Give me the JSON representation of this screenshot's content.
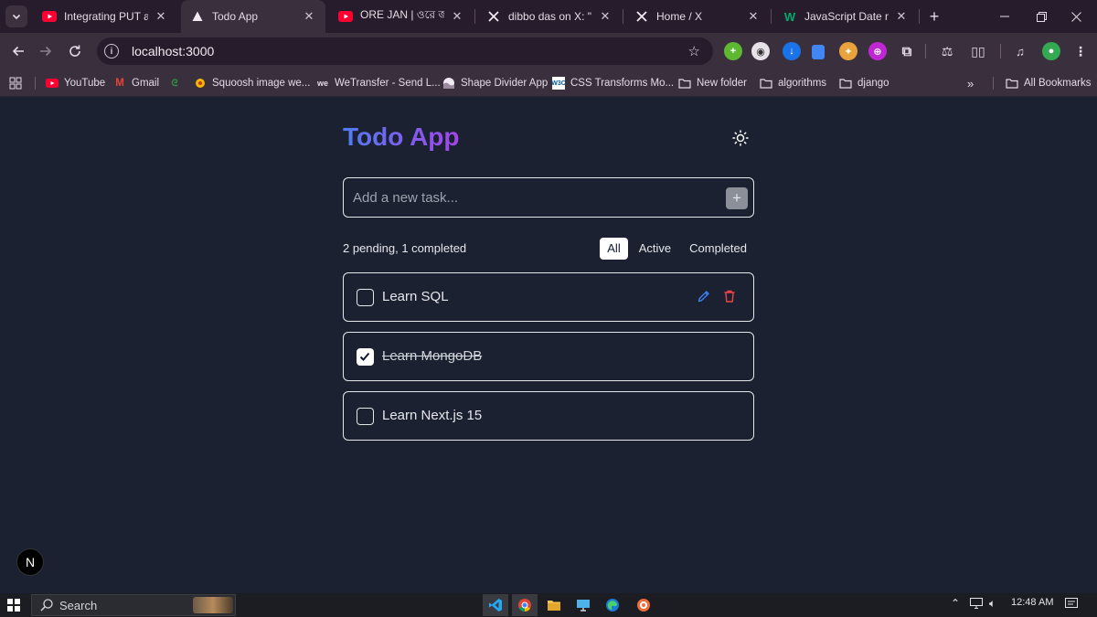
{
  "browser": {
    "tabs": [
      {
        "title": "Integrating PUT and D",
        "favicon": "youtube-icon",
        "active": false
      },
      {
        "title": "Todo App",
        "favicon": "nextjs-icon",
        "active": true
      },
      {
        "title": "ORE JAN | ওরে জান | (C",
        "favicon": "youtube-icon",
        "active": false
      },
      {
        "title": "dibbo das on X: \"🚀 W",
        "favicon": "x-icon",
        "active": false
      },
      {
        "title": "Home / X",
        "favicon": "x-icon",
        "active": false
      },
      {
        "title": "JavaScript Date now()",
        "favicon": "w3schools-icon",
        "active": false
      }
    ],
    "url": "localhost:3000",
    "bookmarks": [
      {
        "label": "YouTube",
        "icon": "youtube-icon"
      },
      {
        "label": "Gmail",
        "icon": "gmail-icon"
      },
      {
        "label": "",
        "icon": "geeksforgeeks-icon"
      },
      {
        "label": "Squoosh image we...",
        "icon": "squoosh-icon"
      },
      {
        "label": "WeTransfer - Send L...",
        "icon": "wetransfer-icon"
      },
      {
        "label": "Shape Divider App",
        "icon": "shape-divider-icon"
      },
      {
        "label": "CSS Transforms Mo...",
        "icon": "w3c-icon"
      },
      {
        "label": "New folder",
        "icon": "folder-icon"
      },
      {
        "label": "algorithms",
        "icon": "folder-icon"
      },
      {
        "label": "django",
        "icon": "folder-icon"
      }
    ],
    "all_bookmarks_label": "All Bookmarks"
  },
  "app": {
    "title": "Todo App",
    "add_placeholder": "Add a new task...",
    "add_button": "+",
    "status": "2 pending, 1 completed",
    "filters": [
      {
        "label": "All",
        "selected": true
      },
      {
        "label": "Active",
        "selected": false
      },
      {
        "label": "Completed",
        "selected": false
      }
    ],
    "todos": [
      {
        "text": "Learn SQL",
        "completed": false,
        "show_actions": true
      },
      {
        "text": "Learn MongoDB",
        "completed": true,
        "show_actions": false
      },
      {
        "text": "Learn Next.js 15",
        "completed": false,
        "show_actions": false
      }
    ],
    "next_badge": "N",
    "colors": {
      "title_from": "#4f7df3",
      "title_to": "#a445e8",
      "edit": "#3b82f6",
      "delete": "#ef4444"
    }
  },
  "taskbar": {
    "search_label": "Search",
    "time": "12:48 AM"
  }
}
